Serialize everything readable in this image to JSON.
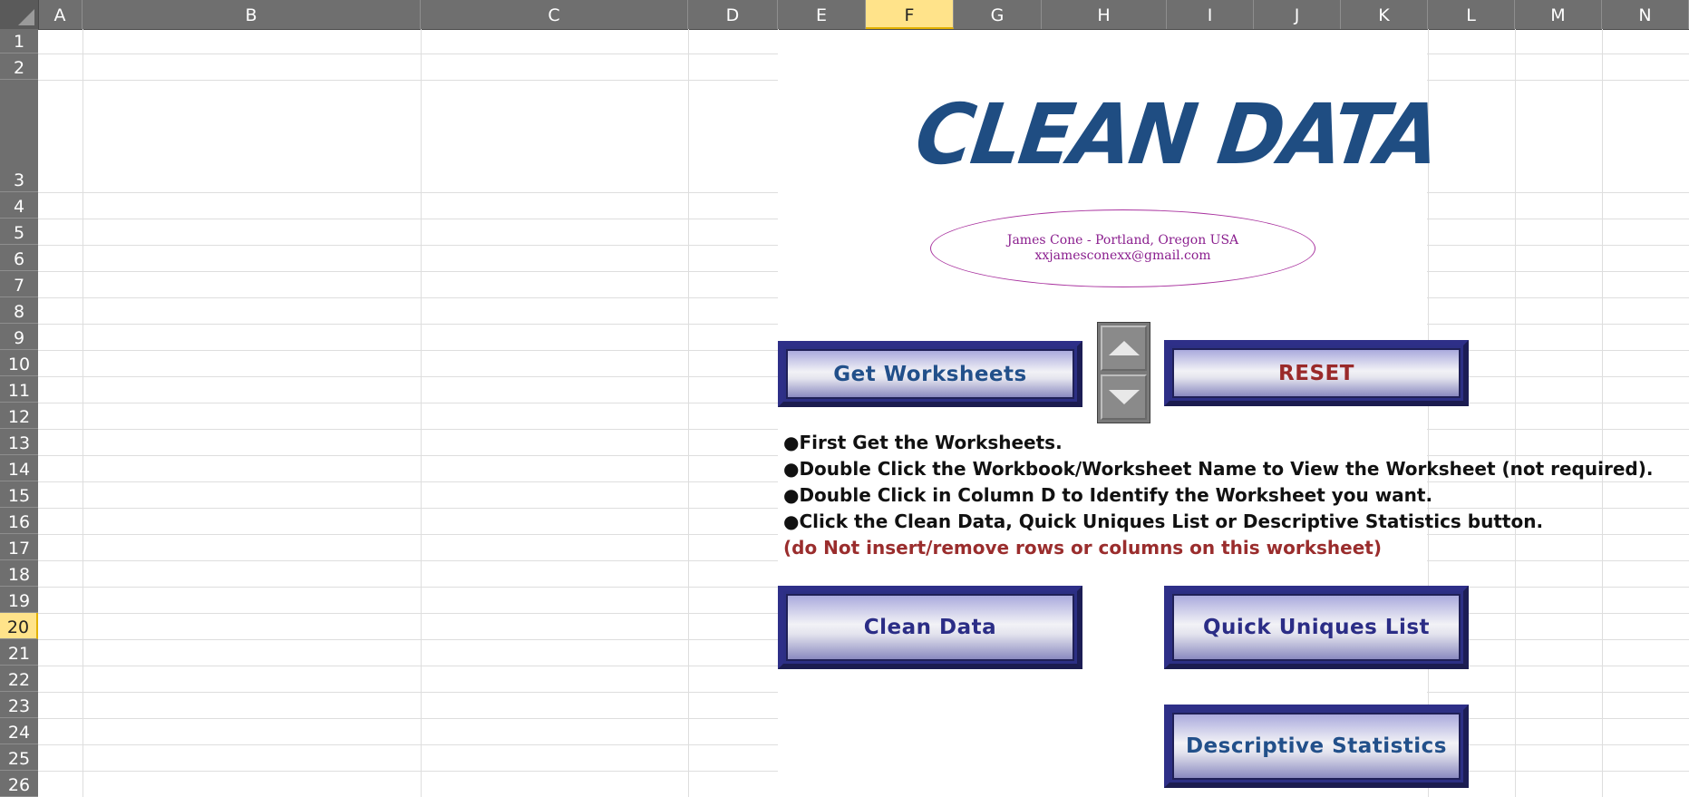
{
  "columns": [
    "A",
    "B",
    "C",
    "D",
    "E",
    "F",
    "G",
    "H",
    "I",
    "J",
    "K",
    "L",
    "M",
    "N"
  ],
  "selected_column": "F",
  "rows": [
    "1",
    "2",
    "3",
    "4",
    "5",
    "6",
    "7",
    "8",
    "9",
    "10",
    "11",
    "12",
    "13",
    "14",
    "15",
    "16",
    "17",
    "18",
    "19",
    "20",
    "21",
    "22",
    "23",
    "24",
    "25",
    "26"
  ],
  "selected_row": "20",
  "title": "CLEAN DATA",
  "author": {
    "line1": "James Cone - Portland, Oregon USA",
    "line2": "xxjamesconexx@gmail.com"
  },
  "buttons": {
    "get_worksheets": "Get Worksheets",
    "reset": "RESET",
    "clean_data": "Clean Data",
    "quick_uniques": "Quick Uniques List",
    "descriptive_stats": "Descriptive Statistics"
  },
  "instructions": [
    "●First Get the Worksheets.",
    "●Double Click the Workbook/Worksheet Name to View the Worksheet (not required).",
    "●Double Click in Column D to Identify the Worksheet you want.",
    "●Click the Clean Data, Quick Uniques List or Descriptive Statistics button."
  ],
  "warning": "(do Not insert/remove rows or columns on this worksheet)",
  "colors": {
    "title": "#1f4d82",
    "warning": "#9a2d2d",
    "button_frame": "#2e2f88",
    "selection": "#ffe38a"
  }
}
